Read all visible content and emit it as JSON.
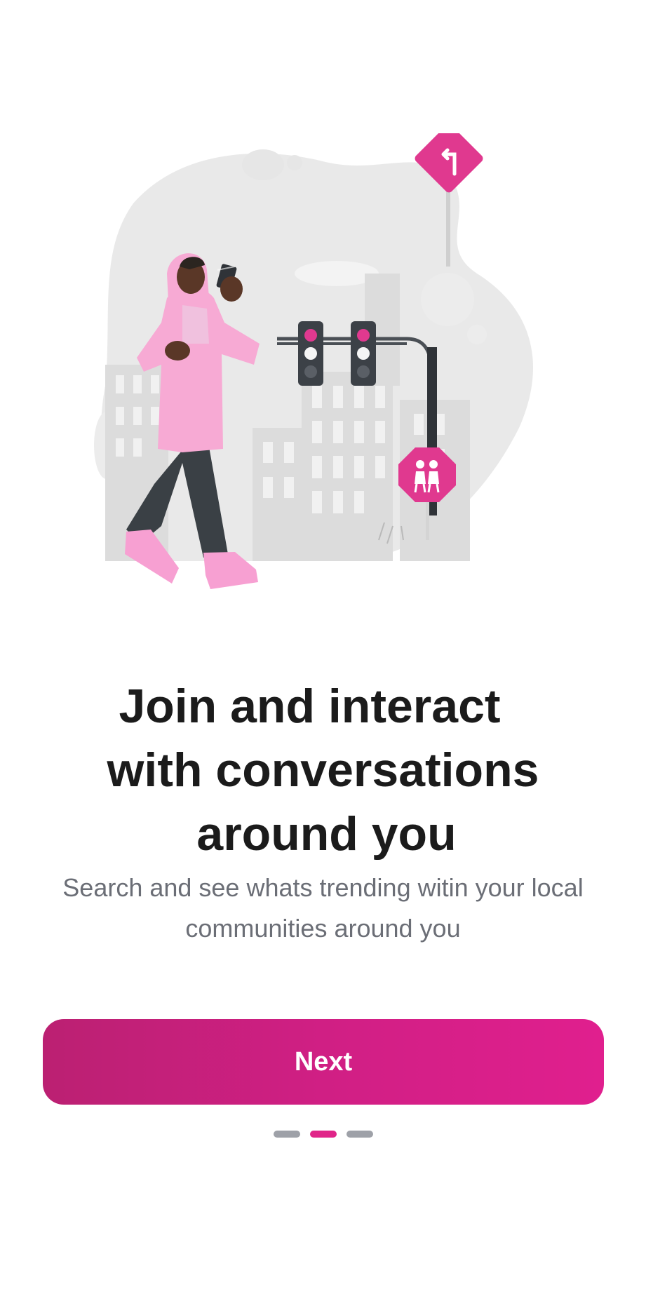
{
  "onboarding": {
    "title_lines": [
      "Join and interact",
      "with conversations",
      "around you"
    ],
    "subtitle_lines": [
      "Search and see whats trending witin your local",
      "communities around you"
    ],
    "next_label": "Next",
    "page_indicator": {
      "total": 3,
      "active": 2
    }
  },
  "illustration": {
    "name": "person-walking-with-phone-illustration",
    "icons": [
      "turn-left-sign-icon",
      "traffic-light-icon",
      "pedestrian-crossing-sign-icon"
    ]
  },
  "colors": {
    "accent": "#e02589",
    "button_gradient_start": "#bb2072",
    "button_gradient_end": "#e01f8e",
    "dot_inactive": "#9ea1a8",
    "title": "#1b1b1b",
    "subtitle": "#6b6e76"
  }
}
